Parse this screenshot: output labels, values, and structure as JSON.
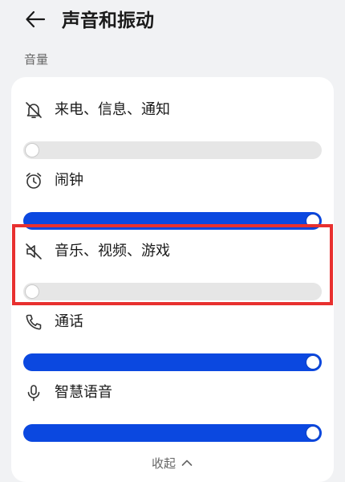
{
  "header": {
    "title": "声音和振动"
  },
  "section": {
    "label": "音量"
  },
  "rows": [
    {
      "label": "来电、信息、通知",
      "icon": "bell-muted-icon",
      "level": 0.0
    },
    {
      "label": "闹钟",
      "icon": "alarm-clock-icon",
      "level": 1.0
    },
    {
      "label": "音乐、视频、游戏",
      "icon": "speaker-muted-icon",
      "level": 0.0
    },
    {
      "label": "通话",
      "icon": "phone-icon",
      "level": 1.0
    },
    {
      "label": "智慧语音",
      "icon": "microphone-icon",
      "level": 1.0
    }
  ],
  "footer": {
    "collapse_label": "收起",
    "icon": "chevron-up-icon"
  },
  "colors": {
    "accent": "#0b48e0",
    "highlight": "#e8302f",
    "track": "#e6e6e6",
    "background": "#f1f2f4"
  }
}
